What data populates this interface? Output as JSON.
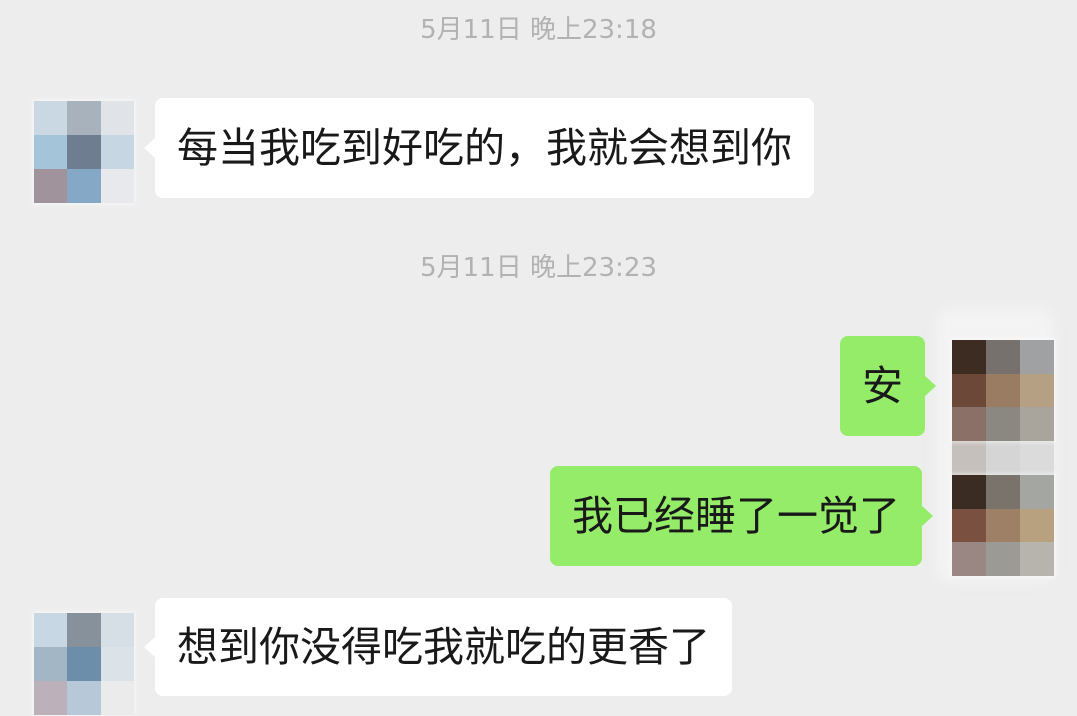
{
  "theme": {
    "chat_background": "#ededed",
    "sent_bubble": "#95ec69",
    "received_bubble": "#ffffff",
    "timestamp_text": "#b2b2b2",
    "message_text": "#191919"
  },
  "chat": {
    "timestamps": [
      "5月11日 晚上23:18",
      "5月11日 晚上23:23"
    ],
    "received_messages": [
      {
        "text": "每当我吃到好吃的，我就会想到你",
        "avatar_mosaic": [
          [
            "#cad8e4",
            "#a8b2bc",
            "#e0e4e8"
          ],
          [
            "#a4c4da",
            "#6e7d8f",
            "#c6d6e2"
          ],
          [
            "#a0939c",
            "#84a8c6",
            "#e8e9ec"
          ]
        ]
      },
      {
        "text": "想到你没得吃我就吃的更香了",
        "avatar_mosaic": [
          [
            "#c7d7e4",
            "#86919c",
            "#d6dee6"
          ],
          [
            "#a3b6c6",
            "#6d8eaa",
            "#dbe2e8"
          ],
          [
            "#bcb0ba",
            "#b7c9d8",
            "#ebebeb"
          ]
        ]
      }
    ],
    "sent_messages": [
      {
        "text": "安",
        "avatar_mosaic": [
          [
            "#3d2c22",
            "#76716c",
            "#9fa1a3"
          ],
          [
            "#6c4838",
            "#9a7c62",
            "#b6a083"
          ],
          [
            "#8a7067",
            "#8b8882",
            "#a9a59c"
          ]
        ]
      },
      {
        "text": "我已经睡了一觉了",
        "avatar_mosaic": [
          [
            "#3b2c23",
            "#7a736b",
            "#a4a6a2"
          ],
          [
            "#7a5040",
            "#9d8066",
            "#b7a17f"
          ],
          [
            "#9a8682",
            "#9c9a95",
            "#b7b3ad"
          ]
        ]
      }
    ]
  }
}
